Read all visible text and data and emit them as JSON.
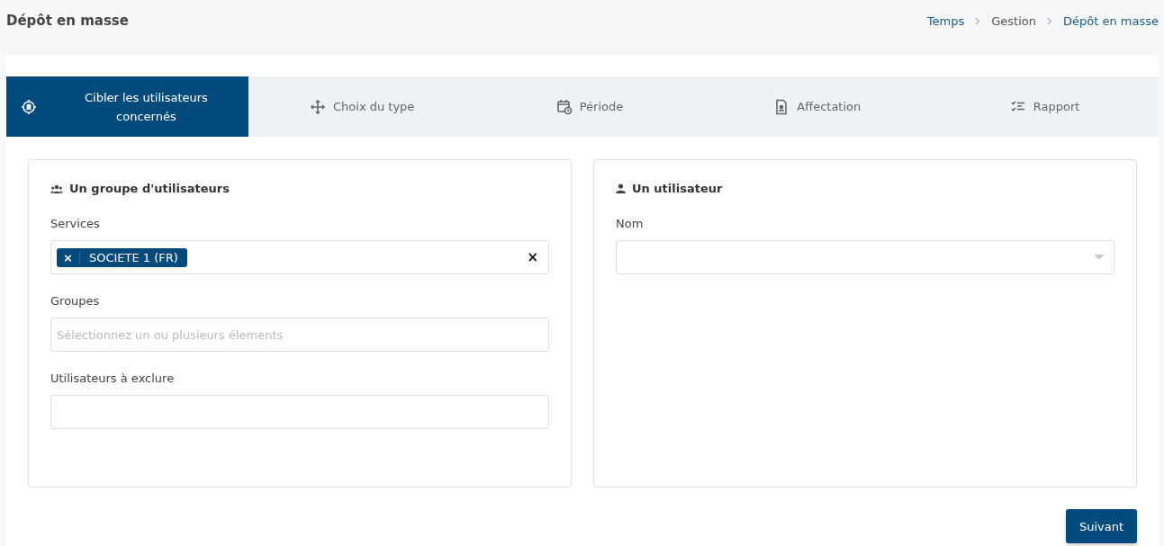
{
  "page_title": "Dépôt en masse",
  "breadcrumb": [
    {
      "label": "Temps",
      "kind": "link"
    },
    {
      "label": "Gestion",
      "kind": "text"
    },
    {
      "label": "Dépôt en masse",
      "kind": "link"
    }
  ],
  "steps": [
    {
      "label": "Cibler les utilisateurs concernés",
      "kind": "target",
      "selected": true
    },
    {
      "label": "Choix du type",
      "kind": "move",
      "selected": false
    },
    {
      "label": "Période",
      "kind": "calendar",
      "selected": false
    },
    {
      "label": "Affectation",
      "kind": "file",
      "selected": false
    },
    {
      "label": "Rapport",
      "kind": "list",
      "selected": false
    }
  ],
  "panels": [
    {
      "title": "Un groupe d'utilisateurs",
      "kind": "group",
      "fields": [
        {
          "label": "Services",
          "kind": "tags",
          "tags": [
            {
              "remove": "×",
              "label": "SOCIETE 1 (FR)"
            }
          ],
          "clear": "×"
        },
        {
          "label": "Groupes",
          "kind": "text",
          "placeholder": "Sélectionnez un ou plusieurs élements"
        },
        {
          "label": "Utilisateurs à exclure",
          "kind": "text"
        }
      ]
    },
    {
      "title": "Un utilisateur",
      "kind": "user",
      "fields": [
        {
          "label": "Nom",
          "kind": "select"
        }
      ]
    }
  ],
  "next_button": "Suivant"
}
